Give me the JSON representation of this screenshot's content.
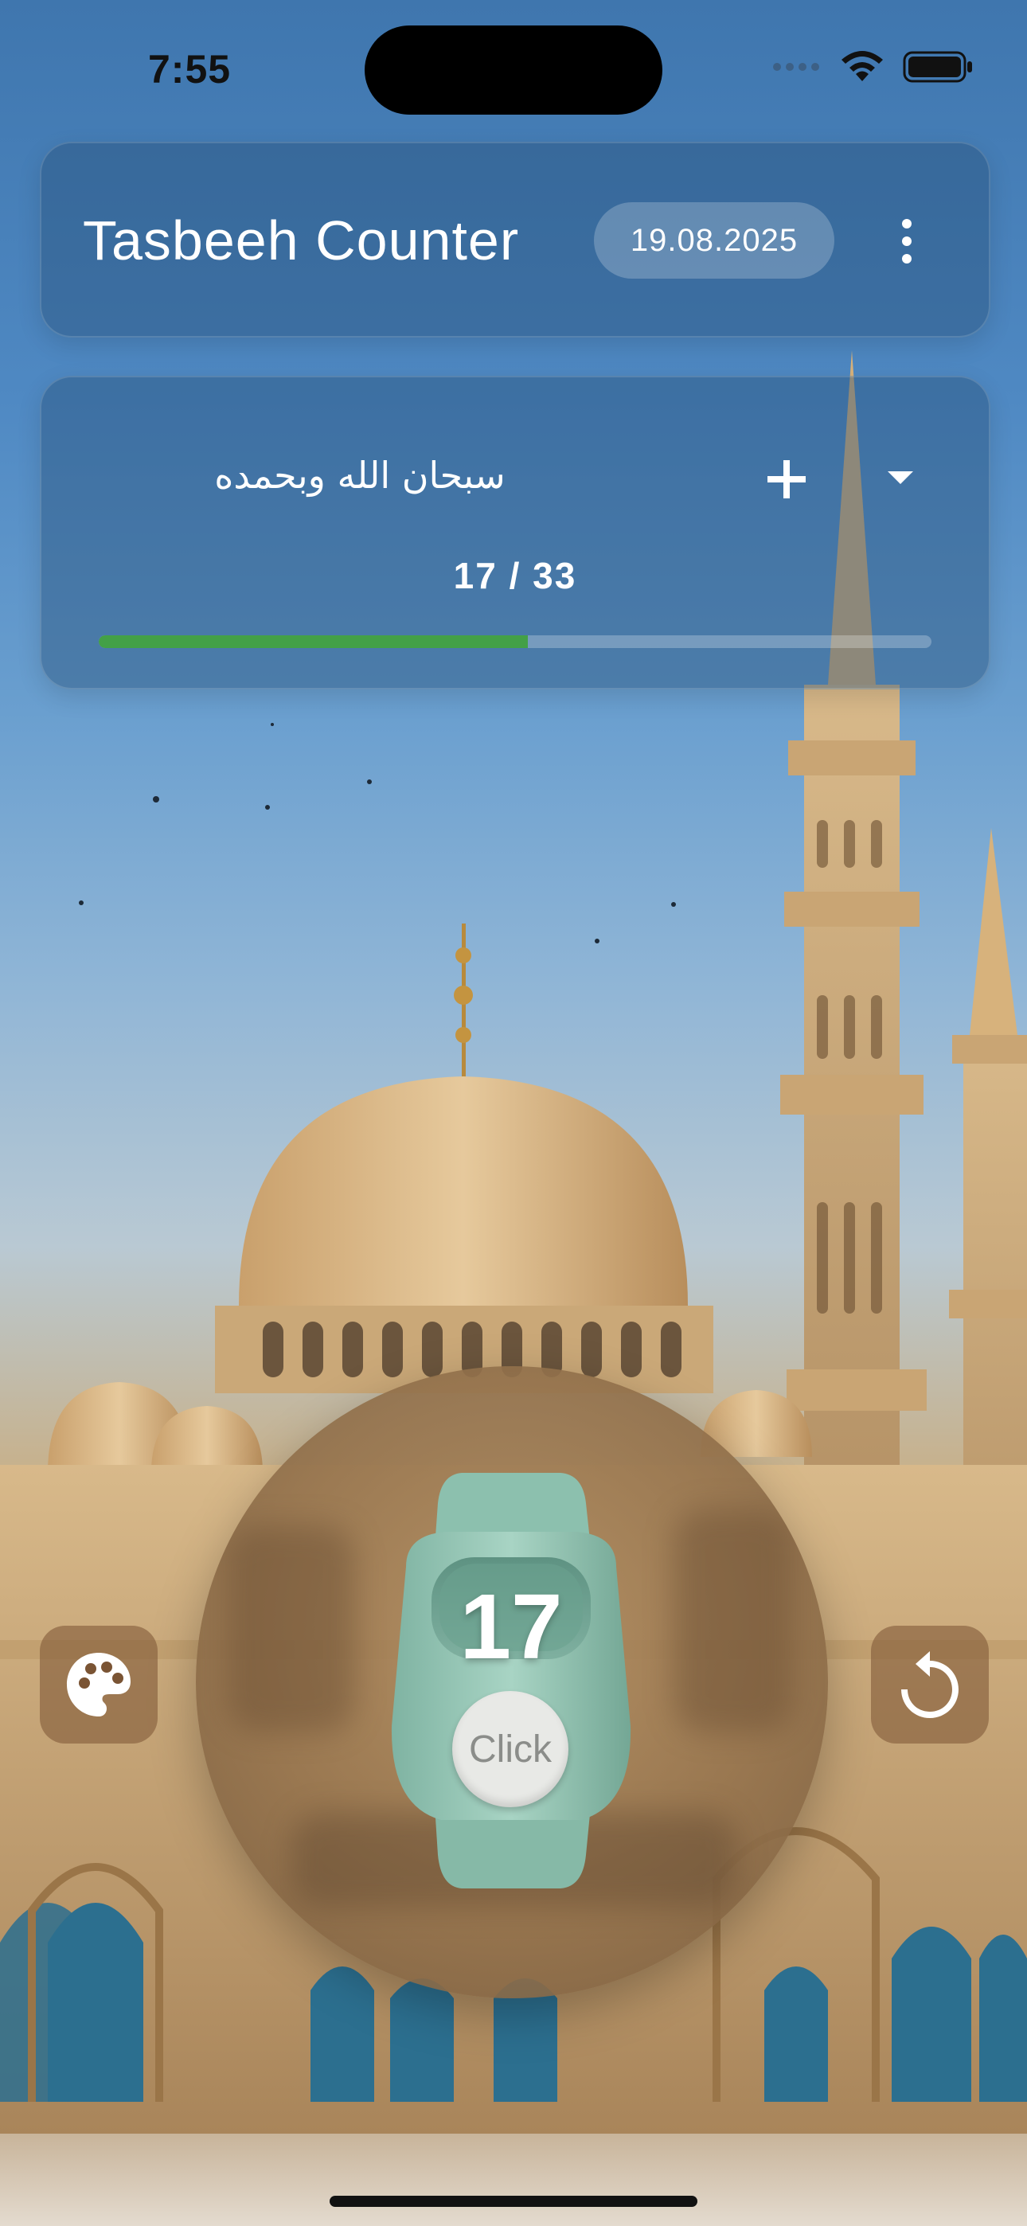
{
  "status_bar": {
    "time": "7:55",
    "icons": [
      "signal-icon",
      "wifi-icon",
      "battery-icon"
    ]
  },
  "header": {
    "title": "Tasbeeh Counter",
    "date": "19.08.2025",
    "menu_icon": "more-vert-icon"
  },
  "dhikr": {
    "text": "سبحان الله وبحمده",
    "progress_text": "17 / 33",
    "current": 17,
    "target": 33,
    "progress_color": "#43a047",
    "add_icon": "plus-icon",
    "dropdown_icon": "caret-down-icon"
  },
  "counter": {
    "value": "17",
    "click_label": "Click",
    "device_color": "#8fc2b0"
  },
  "actions": {
    "theme_icon": "palette-icon",
    "reset_icon": "reset-icon"
  }
}
